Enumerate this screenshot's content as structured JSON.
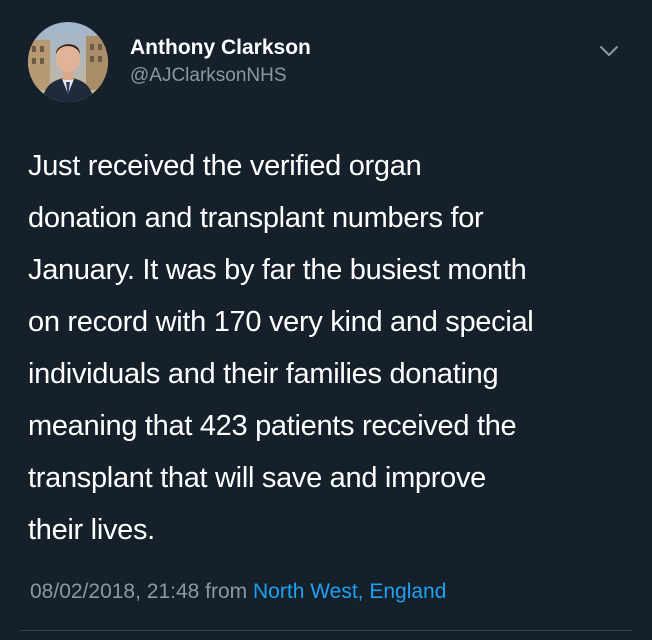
{
  "user": {
    "display_name": "Anthony Clarkson",
    "handle": "@AJClarksonNHS"
  },
  "tweet": {
    "lines": [
      "Just received the verified organ",
      "donation and transplant numbers for",
      "January. It was by far the busiest month",
      "on record with 170 very kind and special",
      "individuals and their families donating",
      "meaning that 423 patients received the",
      "transplant that will save and improve",
      "their lives."
    ],
    "timestamp": "08/02/2018, 21:48",
    "from_label": "from",
    "location": "North West, England"
  },
  "icons": {
    "menu": "chevron-down-icon",
    "avatar": "avatar"
  },
  "colors": {
    "background": "#15202b",
    "primary_text": "#ffffff",
    "secondary_text": "#8899a6",
    "link": "#1da1f2",
    "divider": "#38444d"
  }
}
